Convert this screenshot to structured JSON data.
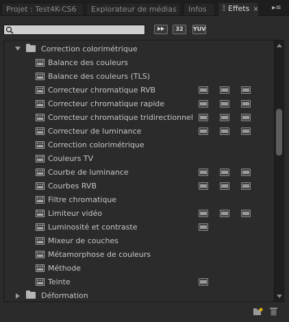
{
  "tabs": [
    {
      "label": "Projet : Test4K-CS6",
      "active": false
    },
    {
      "label": "Explorateur de médias",
      "active": false
    },
    {
      "label": "Infos",
      "active": false
    },
    {
      "label": "Effets",
      "active": true
    }
  ],
  "tab_close_glyph": "×",
  "menu_glyph": "▸≡",
  "search": {
    "value": "",
    "placeholder": ""
  },
  "filters": {
    "accelerated": "",
    "bit32": "32",
    "yuv": "YUV"
  },
  "tree": {
    "folder_open": {
      "label": "Correction colorimétrique",
      "expanded": true
    },
    "effects": [
      {
        "label": "Balance des couleurs",
        "badges": []
      },
      {
        "label": "Balance des couleurs (TLS)",
        "badges": []
      },
      {
        "label": "Correcteur chromatique RVB",
        "badges": [
          "accelerated",
          "32",
          "yuv"
        ]
      },
      {
        "label": "Correcteur chromatique rapide",
        "badges": [
          "accelerated",
          "32",
          "yuv"
        ]
      },
      {
        "label": "Correcteur chromatique tridirectionnel",
        "badges": [
          "accelerated",
          "32",
          "yuv"
        ]
      },
      {
        "label": "Correcteur de luminance",
        "badges": [
          "accelerated",
          "32",
          "yuv"
        ]
      },
      {
        "label": "Correction colorimétrique",
        "badges": []
      },
      {
        "label": "Couleurs TV",
        "badges": []
      },
      {
        "label": "Courbe de luminance",
        "badges": [
          "accelerated",
          "32",
          "yuv"
        ]
      },
      {
        "label": "Courbes RVB",
        "badges": [
          "accelerated",
          "32",
          "yuv"
        ]
      },
      {
        "label": "Filtre chromatique",
        "badges": []
      },
      {
        "label": "Limiteur vidéo",
        "badges": [
          "accelerated",
          "32",
          "yuv"
        ]
      },
      {
        "label": "Luminosité et contraste",
        "badges": [
          "accelerated"
        ]
      },
      {
        "label": "Mixeur de couches",
        "badges": []
      },
      {
        "label": "Métamorphose de couleurs",
        "badges": []
      },
      {
        "label": "Méthode",
        "badges": []
      },
      {
        "label": "Teinte",
        "badges": [
          "accelerated"
        ]
      }
    ],
    "folder_closed": {
      "label": "Déformation",
      "expanded": false
    }
  },
  "icons": {
    "search": "search-icon",
    "folder": "folder-icon",
    "effect": "video-effect-icon",
    "new_bin": "new-bin-icon",
    "trash": "trash-icon"
  },
  "colors": {
    "panel_bg": "#2b2b2b",
    "tab_bar_bg": "#1e1e1e",
    "text": "#c8c8c8",
    "search_bg": "#cfcfcf"
  }
}
